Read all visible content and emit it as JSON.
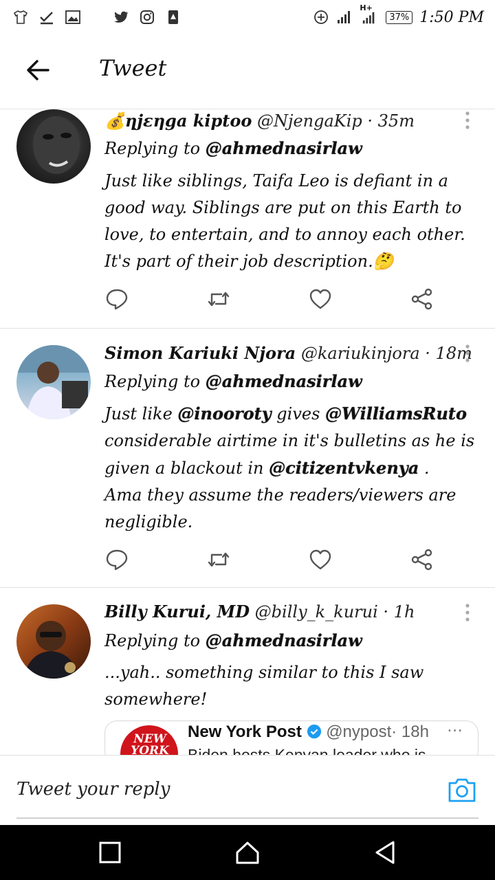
{
  "status_bar": {
    "time": "1:50 PM",
    "network": "H+",
    "battery": "37%"
  },
  "header": {
    "title": "Tweet"
  },
  "tweets": [
    {
      "name": "💰ηjεηga kiptoo",
      "handle": "@NjengaKip",
      "time": "· 35m",
      "replying_prefix": "Replying to ",
      "replying_to": "@ahmednasirlaw",
      "body": "Just like siblings, Taifa Leo is defiant in a good way. Siblings are put on this Earth to love, to entertain, and to annoy each other. It's part of their job description.🤔"
    },
    {
      "name": "Simon Kariuki Njora",
      "handle": "@kariukinjora",
      "time": "· 18m",
      "replying_prefix": "Replying to ",
      "replying_to": "@ahmednasirlaw",
      "body_parts": {
        "p1": "Just like ",
        "m1": "@inooroty",
        "p2": " gives ",
        "m2": "@WilliamsRuto",
        "p3": " considerable airtime in it's bulletins as he is given a blackout in ",
        "m3": "@citizentvkenya",
        "p4": " .",
        "p5": "Ama they assume the readers/viewers are negligible."
      }
    },
    {
      "name": "Billy Kurui, MD",
      "handle": "@billy_k_kurui",
      "time": "· 1h",
      "replying_prefix": "Replying to ",
      "replying_to": "@ahmednasirlaw",
      "body": "...yah.. something similar to this I saw somewhere!",
      "quote": {
        "name": "New York Post",
        "handle": "@nypost",
        "time": "· 18h",
        "logo_text": "NEW YORK",
        "text": "Biden hosts Kenyan leader who is"
      }
    }
  ],
  "reply_bar": {
    "placeholder": "Tweet your reply"
  },
  "colors": {
    "accent": "#1da1f2",
    "verified": "#1d9bf0",
    "nypost_red": "#d0141b"
  }
}
